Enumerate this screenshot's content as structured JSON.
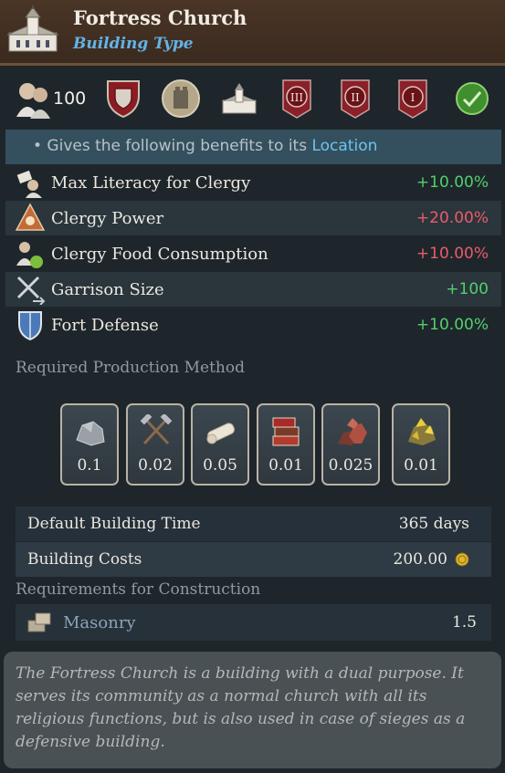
{
  "header": {
    "title": "Fortress Church",
    "subtitle": "Building Type",
    "icon": "church-building-icon"
  },
  "iconbar": {
    "pop_icon": "clergy-pop-icon",
    "pop_count": "100",
    "items": [
      {
        "icon": "shield-badge-icon"
      },
      {
        "icon": "fort-medallion-icon"
      },
      {
        "icon": "church-icon"
      },
      {
        "icon": "tier-3-banner-icon",
        "text": "III"
      },
      {
        "icon": "tier-2-banner-icon",
        "text": "II"
      },
      {
        "icon": "tier-1-banner-icon",
        "text": "I"
      },
      {
        "icon": "checkmark-icon"
      }
    ]
  },
  "benefits": {
    "intro": "• Gives the following benefits to its ",
    "link": "Location",
    "rows": [
      {
        "icon": "literacy-icon",
        "label": "Max Literacy for Clergy",
        "value": "+10.00%",
        "status": "positive"
      },
      {
        "icon": "clergy-power-icon",
        "label": "Clergy Power",
        "value": "+20.00%",
        "status": "negative"
      },
      {
        "icon": "food-consumption-icon",
        "label": "Clergy Food Consumption",
        "value": "+10.00%",
        "status": "negative"
      },
      {
        "icon": "garrison-icon",
        "label": "Garrison Size",
        "value": "+100",
        "status": "positive"
      },
      {
        "icon": "fort-defense-icon",
        "label": "Fort Defense",
        "value": "+10.00%",
        "status": "positive"
      }
    ]
  },
  "production": {
    "label": "Required Production Method",
    "goods": [
      {
        "icon": "stone-icon",
        "value": "0.1"
      },
      {
        "icon": "tools-icon",
        "value": "0.02"
      },
      {
        "icon": "cloth-icon",
        "value": "0.05"
      },
      {
        "icon": "books-icon",
        "value": "0.01"
      },
      {
        "icon": "copper-icon",
        "value": "0.025"
      },
      {
        "icon": "gold-ore-icon",
        "value": "0.01"
      }
    ]
  },
  "info": {
    "build_time_label": "Default Building Time",
    "build_time_value": "365 days",
    "cost_label": "Building Costs",
    "cost_value": "200.00",
    "cost_icon": "gold-coin-icon"
  },
  "requirements": {
    "label": "Requirements for Construction",
    "items": [
      {
        "icon": "masonry-icon",
        "label": "Masonry",
        "value": "1.5"
      }
    ]
  },
  "description": "The Fortress Church is a building with a dual purpose. It serves its community as a normal church with all its religious functions, but is also used in case of sieges as a defensive building.",
  "colors": {
    "positive": "#52d06c",
    "negative": "#ec5b68",
    "link": "#6cc4f0",
    "subtitle": "#63b3e6"
  }
}
